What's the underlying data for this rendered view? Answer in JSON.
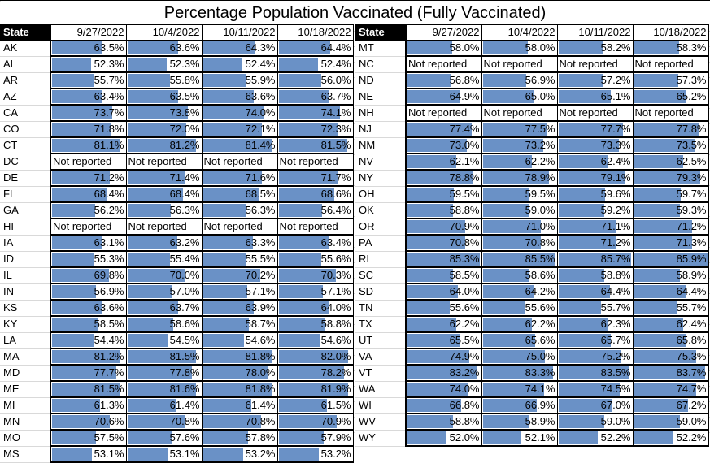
{
  "title": "Percentage Population Vaccinated (Fully Vaccinated)",
  "header": {
    "state": "State",
    "dates": [
      "9/27/2022",
      "10/4/2022",
      "10/11/2022",
      "10/18/2022"
    ]
  },
  "bar_color": "#6a91c6",
  "not_reported_label": "Not reported",
  "left_rows": [
    {
      "state": "AK",
      "values": [
        "63.5%",
        "63.6%",
        "64.3%",
        "64.4%"
      ]
    },
    {
      "state": "AL",
      "values": [
        "52.3%",
        "52.3%",
        "52.4%",
        "52.4%"
      ]
    },
    {
      "state": "AR",
      "values": [
        "55.7%",
        "55.8%",
        "55.9%",
        "56.0%"
      ]
    },
    {
      "state": "AZ",
      "values": [
        "63.4%",
        "63.5%",
        "63.6%",
        "63.7%"
      ]
    },
    {
      "state": "CA",
      "values": [
        "73.7%",
        "73.8%",
        "74.0%",
        "74.1%"
      ]
    },
    {
      "state": "CO",
      "values": [
        "71.8%",
        "72.0%",
        "72.1%",
        "72.3%"
      ]
    },
    {
      "state": "CT",
      "values": [
        "81.1%",
        "81.2%",
        "81.4%",
        "81.5%"
      ]
    },
    {
      "state": "DC",
      "values": [
        "Not reported",
        "Not reported",
        "Not reported",
        "Not reported"
      ]
    },
    {
      "state": "DE",
      "values": [
        "71.2%",
        "71.4%",
        "71.6%",
        "71.7%"
      ]
    },
    {
      "state": "FL",
      "values": [
        "68.4%",
        "68.4%",
        "68.5%",
        "68.6%"
      ]
    },
    {
      "state": "GA",
      "values": [
        "56.2%",
        "56.3%",
        "56.3%",
        "56.4%"
      ]
    },
    {
      "state": "HI",
      "values": [
        "Not reported",
        "Not reported",
        "Not reported",
        "Not reported"
      ]
    },
    {
      "state": "IA",
      "values": [
        "63.1%",
        "63.2%",
        "63.3%",
        "63.4%"
      ]
    },
    {
      "state": "ID",
      "values": [
        "55.3%",
        "55.4%",
        "55.5%",
        "55.6%"
      ]
    },
    {
      "state": "IL",
      "values": [
        "69.8%",
        "70.0%",
        "70.2%",
        "70.3%"
      ]
    },
    {
      "state": "IN",
      "values": [
        "56.9%",
        "57.0%",
        "57.1%",
        "57.1%"
      ]
    },
    {
      "state": "KS",
      "values": [
        "63.6%",
        "63.7%",
        "63.9%",
        "64.0%"
      ]
    },
    {
      "state": "KY",
      "values": [
        "58.5%",
        "58.6%",
        "58.7%",
        "58.8%"
      ]
    },
    {
      "state": "LA",
      "values": [
        "54.4%",
        "54.5%",
        "54.6%",
        "54.6%"
      ]
    },
    {
      "state": "MA",
      "values": [
        "81.2%",
        "81.5%",
        "81.8%",
        "82.0%"
      ]
    },
    {
      "state": "MD",
      "values": [
        "77.7%",
        "77.8%",
        "78.0%",
        "78.2%"
      ]
    },
    {
      "state": "ME",
      "values": [
        "81.5%",
        "81.6%",
        "81.8%",
        "81.9%"
      ]
    },
    {
      "state": "MI",
      "values": [
        "61.3%",
        "61.4%",
        "61.4%",
        "61.5%"
      ]
    },
    {
      "state": "MN",
      "values": [
        "70.6%",
        "70.8%",
        "70.8%",
        "70.9%"
      ]
    },
    {
      "state": "MO",
      "values": [
        "57.5%",
        "57.6%",
        "57.8%",
        "57.9%"
      ]
    },
    {
      "state": "MS",
      "values": [
        "53.1%",
        "53.1%",
        "53.2%",
        "53.2%"
      ]
    }
  ],
  "right_rows": [
    {
      "state": "MT",
      "values": [
        "58.0%",
        "58.0%",
        "58.2%",
        "58.3%"
      ]
    },
    {
      "state": "NC",
      "values": [
        "Not reported",
        "Not reported",
        "Not reported",
        "Not reported"
      ]
    },
    {
      "state": "ND",
      "values": [
        "56.8%",
        "56.9%",
        "57.2%",
        "57.3%"
      ]
    },
    {
      "state": "NE",
      "values": [
        "64.9%",
        "65.0%",
        "65.1%",
        "65.2%"
      ]
    },
    {
      "state": "NH",
      "values": [
        "Not reported",
        "Not reported",
        "Not reported",
        "Not reported"
      ]
    },
    {
      "state": "NJ",
      "values": [
        "77.4%",
        "77.5%",
        "77.7%",
        "77.8%"
      ]
    },
    {
      "state": "NM",
      "values": [
        "73.0%",
        "73.2%",
        "73.3%",
        "73.5%"
      ]
    },
    {
      "state": "NV",
      "values": [
        "62.1%",
        "62.2%",
        "62.4%",
        "62.5%"
      ]
    },
    {
      "state": "NY",
      "values": [
        "78.8%",
        "78.9%",
        "79.1%",
        "79.3%"
      ]
    },
    {
      "state": "OH",
      "values": [
        "59.5%",
        "59.5%",
        "59.6%",
        "59.7%"
      ]
    },
    {
      "state": "OK",
      "values": [
        "58.8%",
        "59.0%",
        "59.2%",
        "59.3%"
      ]
    },
    {
      "state": "OR",
      "values": [
        "70.9%",
        "71.0%",
        "71.1%",
        "71.2%"
      ]
    },
    {
      "state": "PA",
      "values": [
        "70.8%",
        "70.8%",
        "71.2%",
        "71.3%"
      ]
    },
    {
      "state": "RI",
      "values": [
        "85.3%",
        "85.5%",
        "85.7%",
        "85.9%"
      ]
    },
    {
      "state": "SC",
      "values": [
        "58.5%",
        "58.6%",
        "58.8%",
        "58.9%"
      ]
    },
    {
      "state": "SD",
      "values": [
        "64.0%",
        "64.2%",
        "64.4%",
        "64.4%"
      ]
    },
    {
      "state": "TN",
      "values": [
        "55.6%",
        "55.6%",
        "55.7%",
        "55.7%"
      ]
    },
    {
      "state": "TX",
      "values": [
        "62.2%",
        "62.2%",
        "62.3%",
        "62.4%"
      ]
    },
    {
      "state": "UT",
      "values": [
        "65.5%",
        "65.6%",
        "65.7%",
        "65.8%"
      ]
    },
    {
      "state": "VA",
      "values": [
        "74.9%",
        "75.0%",
        "75.2%",
        "75.3%"
      ]
    },
    {
      "state": "VT",
      "values": [
        "83.2%",
        "83.3%",
        "83.5%",
        "83.7%"
      ]
    },
    {
      "state": "WA",
      "values": [
        "74.0%",
        "74.1%",
        "74.5%",
        "74.7%"
      ]
    },
    {
      "state": "WI",
      "values": [
        "66.8%",
        "66.9%",
        "67.0%",
        "67.2%"
      ]
    },
    {
      "state": "WV",
      "values": [
        "58.8%",
        "58.9%",
        "59.0%",
        "59.0%"
      ]
    },
    {
      "state": "WY",
      "values": [
        "52.0%",
        "52.1%",
        "52.2%",
        "52.2%"
      ]
    }
  ]
}
